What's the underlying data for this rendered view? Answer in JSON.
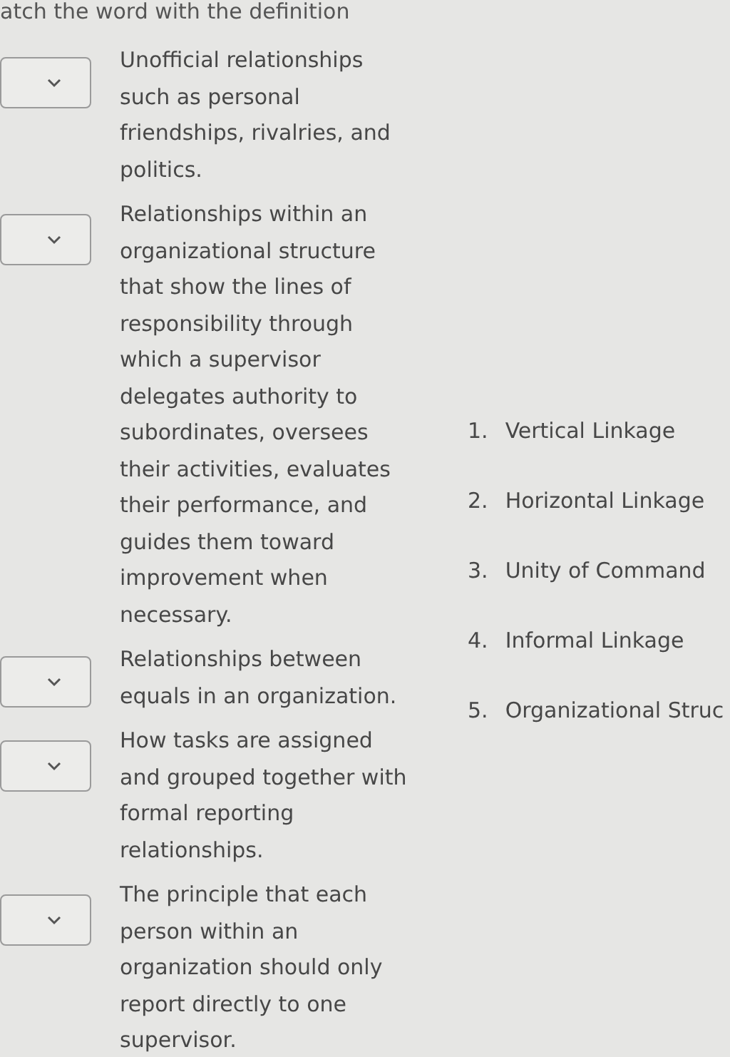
{
  "title": "atch the word with the definition",
  "definitions": [
    {
      "text": "Unofficial relationships such as personal friendships, rivalries, and politics."
    },
    {
      "text": "Relationships within an organizational structure that show the lines of responsibility through which a supervisor delegates authority to subordinates, oversees their activities, evaluates their performance, and guides them toward improvement when necessary."
    },
    {
      "text": "Relationships between equals in an organization."
    },
    {
      "text": "How tasks are assigned and grouped together with formal reporting relationships."
    },
    {
      "text": "The principle that each person within an organization should only report directly to one supervisor."
    }
  ],
  "terms": [
    {
      "number": "1.",
      "label": "Vertical Linkage"
    },
    {
      "number": "2.",
      "label": "Horizontal Linkage"
    },
    {
      "number": "3.",
      "label": "Unity of Command"
    },
    {
      "number": "4.",
      "label": "Informal Linkage"
    },
    {
      "number": "5.",
      "label": "Organizational Struc"
    }
  ]
}
